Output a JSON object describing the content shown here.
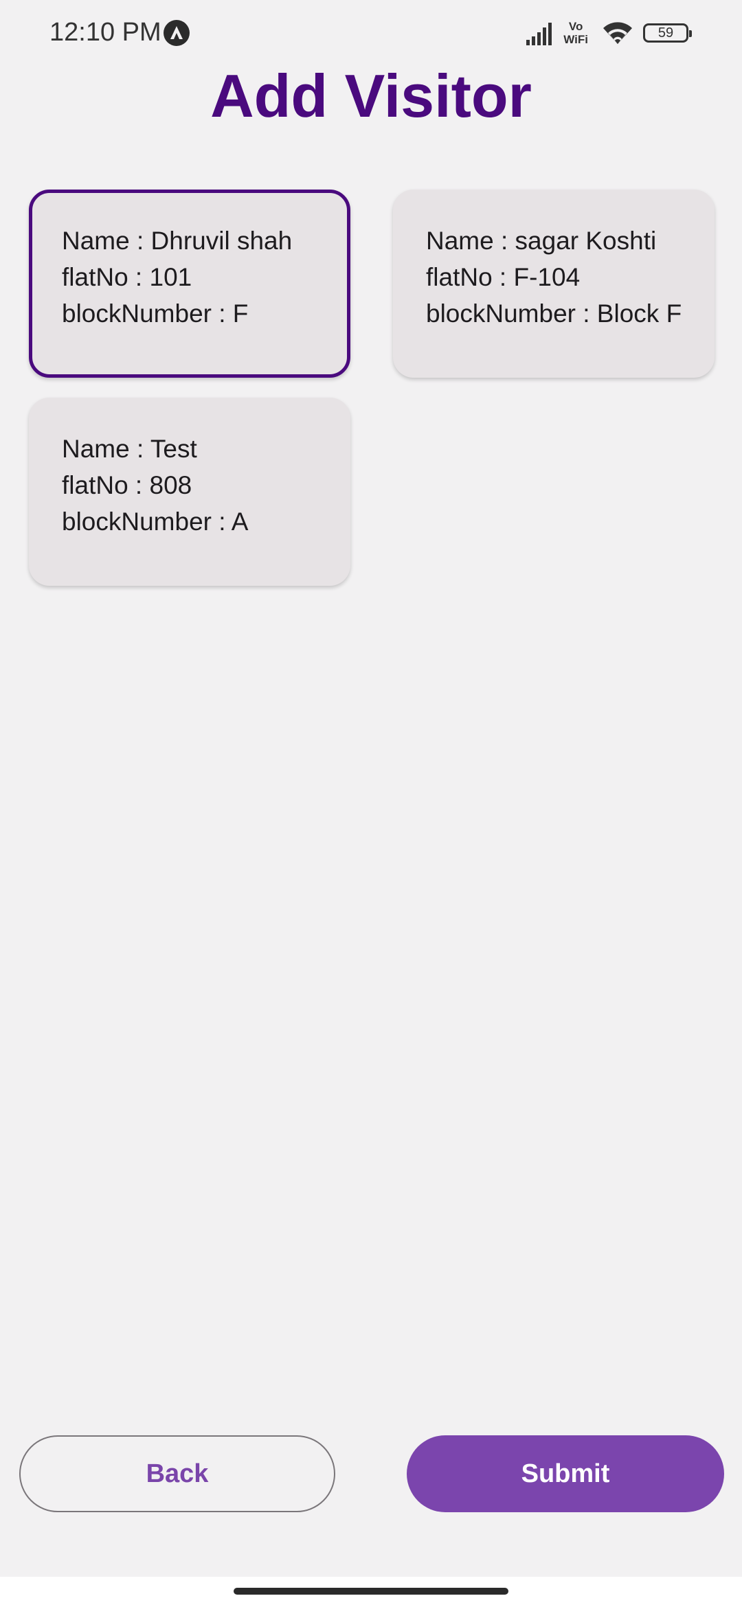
{
  "status_bar": {
    "time": "12:10 PM",
    "vowifi_top": "Vo",
    "vowifi_bottom": "WiFi",
    "battery_level": "59"
  },
  "page": {
    "title": "Add Visitor"
  },
  "cards": [
    {
      "name_line": "Name : Dhruvil shah",
      "flat_line": "flatNo : 101",
      "block_line": "blockNumber : F",
      "selected": true
    },
    {
      "name_line": "Name : sagar Koshti",
      "flat_line": "flatNo : F-104",
      "block_line": "blockNumber : Block F",
      "selected": false
    },
    {
      "name_line": "Name : Test",
      "flat_line": "flatNo : 808",
      "block_line": "blockNumber : A",
      "selected": false
    }
  ],
  "actions": {
    "back_label": "Back",
    "submit_label": "Submit"
  },
  "colors": {
    "title": "#4a0a7e",
    "selected_border": "#4a0a7e",
    "submit_bg": "#7b45ad",
    "back_text": "#7a45aa",
    "card_bg": "#e7e3e5",
    "page_bg": "#f2f1f2"
  },
  "icons": {
    "app_notification": "app-notification-icon",
    "signal": "signal-strength-icon",
    "wifi": "wifi-icon",
    "battery": "battery-icon"
  }
}
